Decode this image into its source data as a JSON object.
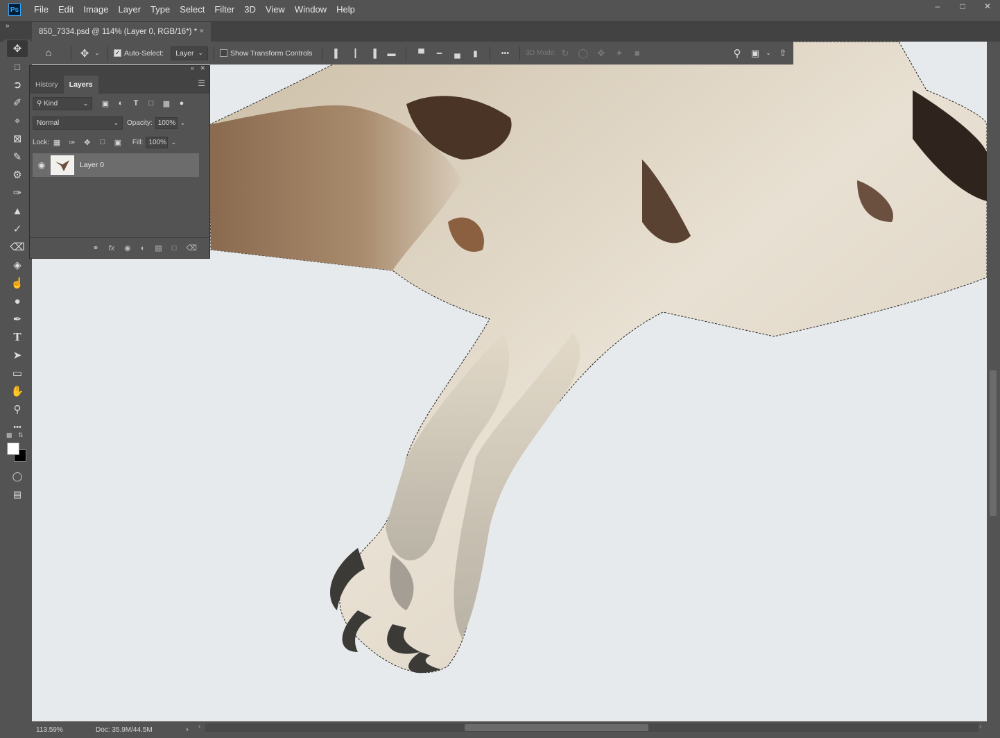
{
  "app": {
    "logo": "Ps"
  },
  "menu": [
    "File",
    "Edit",
    "Image",
    "Layer",
    "Type",
    "Select",
    "Filter",
    "3D",
    "View",
    "Window",
    "Help"
  ],
  "window_controls": {
    "minimize": "–",
    "maximize": "□",
    "close": "✕"
  },
  "document_tab": {
    "title": "850_7334.psd @ 114% (Layer 0, RGB/16*) *",
    "close": "×"
  },
  "options_bar": {
    "auto_select_label": "Auto-Select:",
    "auto_select_checked": true,
    "auto_select_target": "Layer",
    "show_transform_label": "Show Transform Controls",
    "show_transform_checked": false,
    "three_d_mode_label": "3D Mode:",
    "more": "•••"
  },
  "layers_panel": {
    "tabs": [
      "History",
      "Layers"
    ],
    "active_tab": "Layers",
    "filter_kind": "Kind",
    "blend_mode": "Normal",
    "opacity_label": "Opacity:",
    "opacity": "100%",
    "lock_label": "Lock:",
    "fill_label": "Fill:",
    "fill": "100%",
    "layers": [
      {
        "name": "Layer 0",
        "visible": true
      }
    ]
  },
  "status_bar": {
    "zoom": "113.59%",
    "doc": "Doc: 35.9M/44.5M"
  },
  "colors": {
    "ui_bg": "#535353",
    "tab_bg": "#424242",
    "canvas_bg": "#e7eaed",
    "accent_ps": "#31a8ff"
  }
}
